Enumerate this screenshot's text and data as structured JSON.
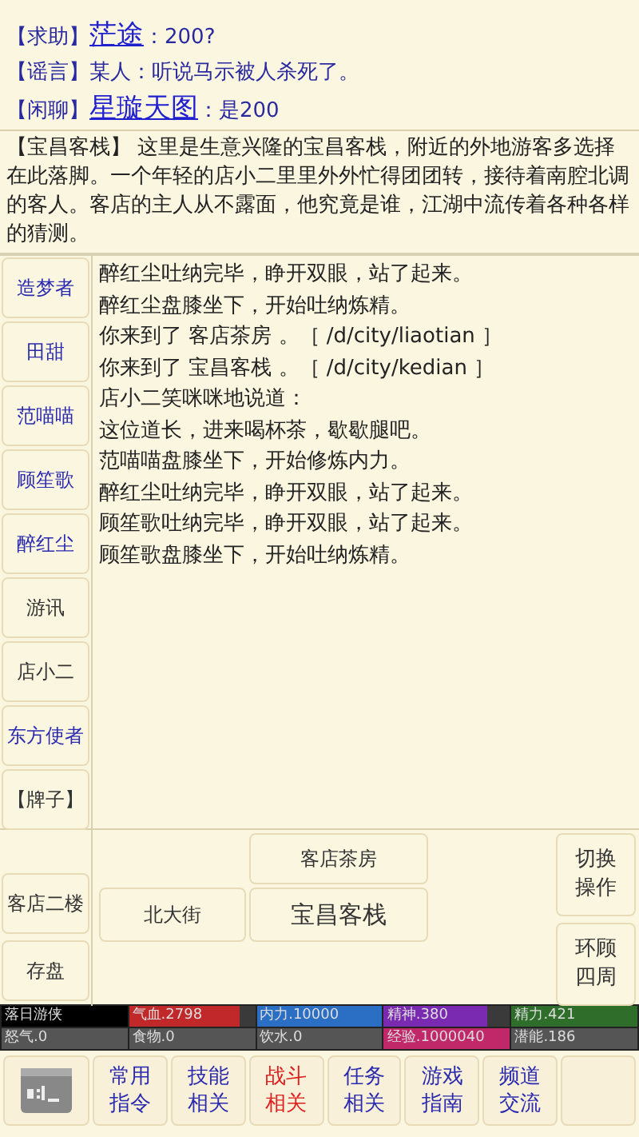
{
  "chat": [
    {
      "channel": "【求助】",
      "name": "茫途",
      "message": "：200?"
    },
    {
      "channel": "【谣言】",
      "message": "某人：听说马示被人杀死了。"
    },
    {
      "channel": "【闲聊】",
      "name": "星璇天图",
      "message": "：是200"
    }
  ],
  "room": {
    "title": "【宝昌客栈】",
    "description": "这里是生意兴隆的宝昌客栈，附近的外地游客多选择在此落脚。一个年轻的店小二里里外外忙得团团转，接待着南腔北调的客人。客店的主人从不露面，他究竟是谁，江湖中流传着各种各样的猜测。"
  },
  "people": [
    {
      "label": "造梦者",
      "kind": "player"
    },
    {
      "label": "田甜",
      "kind": "player"
    },
    {
      "label": "范喵喵",
      "kind": "player"
    },
    {
      "label": "顾笙歌",
      "kind": "player"
    },
    {
      "label": "醉红尘",
      "kind": "player"
    },
    {
      "label": "游讯",
      "kind": "npc"
    },
    {
      "label": "店小二",
      "kind": "npc"
    },
    {
      "label": "东方使者",
      "kind": "player"
    },
    {
      "label": "【牌子】",
      "kind": "npc"
    }
  ],
  "log": [
    "醉红尘吐纳完毕，睁开双眼，站了起来。",
    "醉红尘盘膝坐下，开始吐纳炼精。",
    "你来到了 客店茶房 。［ /d/city/liaotian ］",
    "你来到了 宝昌客栈 。［ /d/city/kedian ］",
    "店小二笑咪咪地说道：",
    "这位道长，进来喝杯茶，歇歇腿吧。",
    "范喵喵盘膝坐下，开始修炼内力。",
    "醉红尘吐纳完毕，睁开双眼，站了起来。",
    "顾笙歌吐纳完毕，睁开双眼，站了起来。",
    "顾笙歌盘膝坐下，开始吐纳炼精。"
  ],
  "side_commands": [
    "客店二楼",
    "存盘"
  ],
  "exits": {
    "north": "客店茶房",
    "west": "北大街",
    "here": "宝昌客栈"
  },
  "actions": [
    "切换操作",
    "环顾四周"
  ],
  "stats": [
    {
      "label": "落日游侠",
      "color": "#000000",
      "level": 1
    },
    {
      "label": "气血.2798",
      "color": "#c0282a",
      "level": 0.88
    },
    {
      "label": "内力.10000",
      "color": "#2a6fc4",
      "level": 1
    },
    {
      "label": "精神.380",
      "color": "#7a2ab0",
      "level": 0.82
    },
    {
      "label": "精力.421",
      "color": "#2e6e2a",
      "level": 1
    },
    {
      "label": "怒气.0",
      "color": "#555555",
      "level": 1
    },
    {
      "label": "食物.0",
      "color": "#555555",
      "level": 1
    },
    {
      "label": "饮水.0",
      "color": "#555555",
      "level": 1
    },
    {
      "label": "经验.1000040",
      "color": "#c0286a",
      "level": 1
    },
    {
      "label": "潜能.186",
      "color": "#555555",
      "level": 1
    }
  ],
  "toolbar": [
    {
      "label": "常用指令",
      "selected": false
    },
    {
      "label": "技能相关",
      "selected": false
    },
    {
      "label": "战斗相关",
      "selected": true
    },
    {
      "label": "任务相关",
      "selected": false
    },
    {
      "label": "游戏指南",
      "selected": false
    },
    {
      "label": "频道交流",
      "selected": false
    }
  ]
}
